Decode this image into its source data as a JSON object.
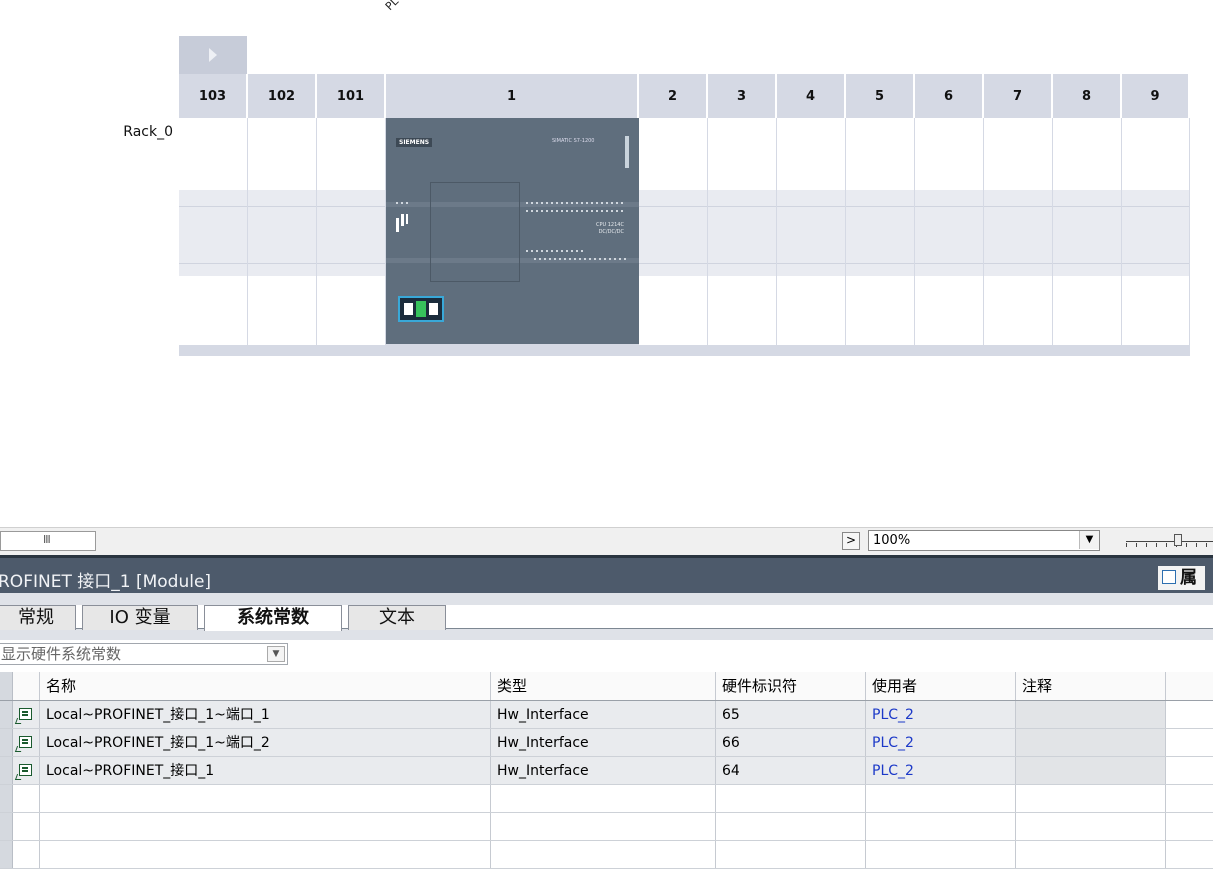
{
  "device_view": {
    "plc_label": "PLC_",
    "rack_name": "Rack_0",
    "slots": [
      "103",
      "102",
      "101",
      "1",
      "2",
      "3",
      "4",
      "5",
      "6",
      "7",
      "8",
      "9"
    ],
    "cpu": {
      "brand": "SIEMENS",
      "model": "SIMATIC S7-1200",
      "cpu_text": "CPU 1214C\nDC/DC/DC"
    }
  },
  "zoom_bar": {
    "scroll_grip": "III",
    "scroll_right": ">",
    "zoom_value": "100%",
    "dropdown_arrow": "▼"
  },
  "properties": {
    "title": "ROFINET 接口_1 [Module]",
    "right_tab": "属",
    "tabs": [
      "常规",
      "IO 变量",
      "系统常数",
      "文本"
    ],
    "active_tab": "系统常数",
    "filter": "显示硬件系统常数",
    "columns": [
      "名称",
      "类型",
      "硬件标识符",
      "使用者",
      "注释"
    ],
    "rows": [
      {
        "name": "Local~PROFINET_接口_1~端口_1",
        "type": "Hw_Interface",
        "hw_id": "65",
        "user": "PLC_2",
        "comment": ""
      },
      {
        "name": "Local~PROFINET_接口_1~端口_2",
        "type": "Hw_Interface",
        "hw_id": "66",
        "user": "PLC_2",
        "comment": ""
      },
      {
        "name": "Local~PROFINET_接口_1",
        "type": "Hw_Interface",
        "hw_id": "64",
        "user": "PLC_2",
        "comment": ""
      }
    ]
  },
  "colors": {
    "title_bar": "#4d5a6b",
    "link": "#1c39c8",
    "rack_header": "#d5d9e4",
    "cpu_body": "#5f6e7d"
  }
}
